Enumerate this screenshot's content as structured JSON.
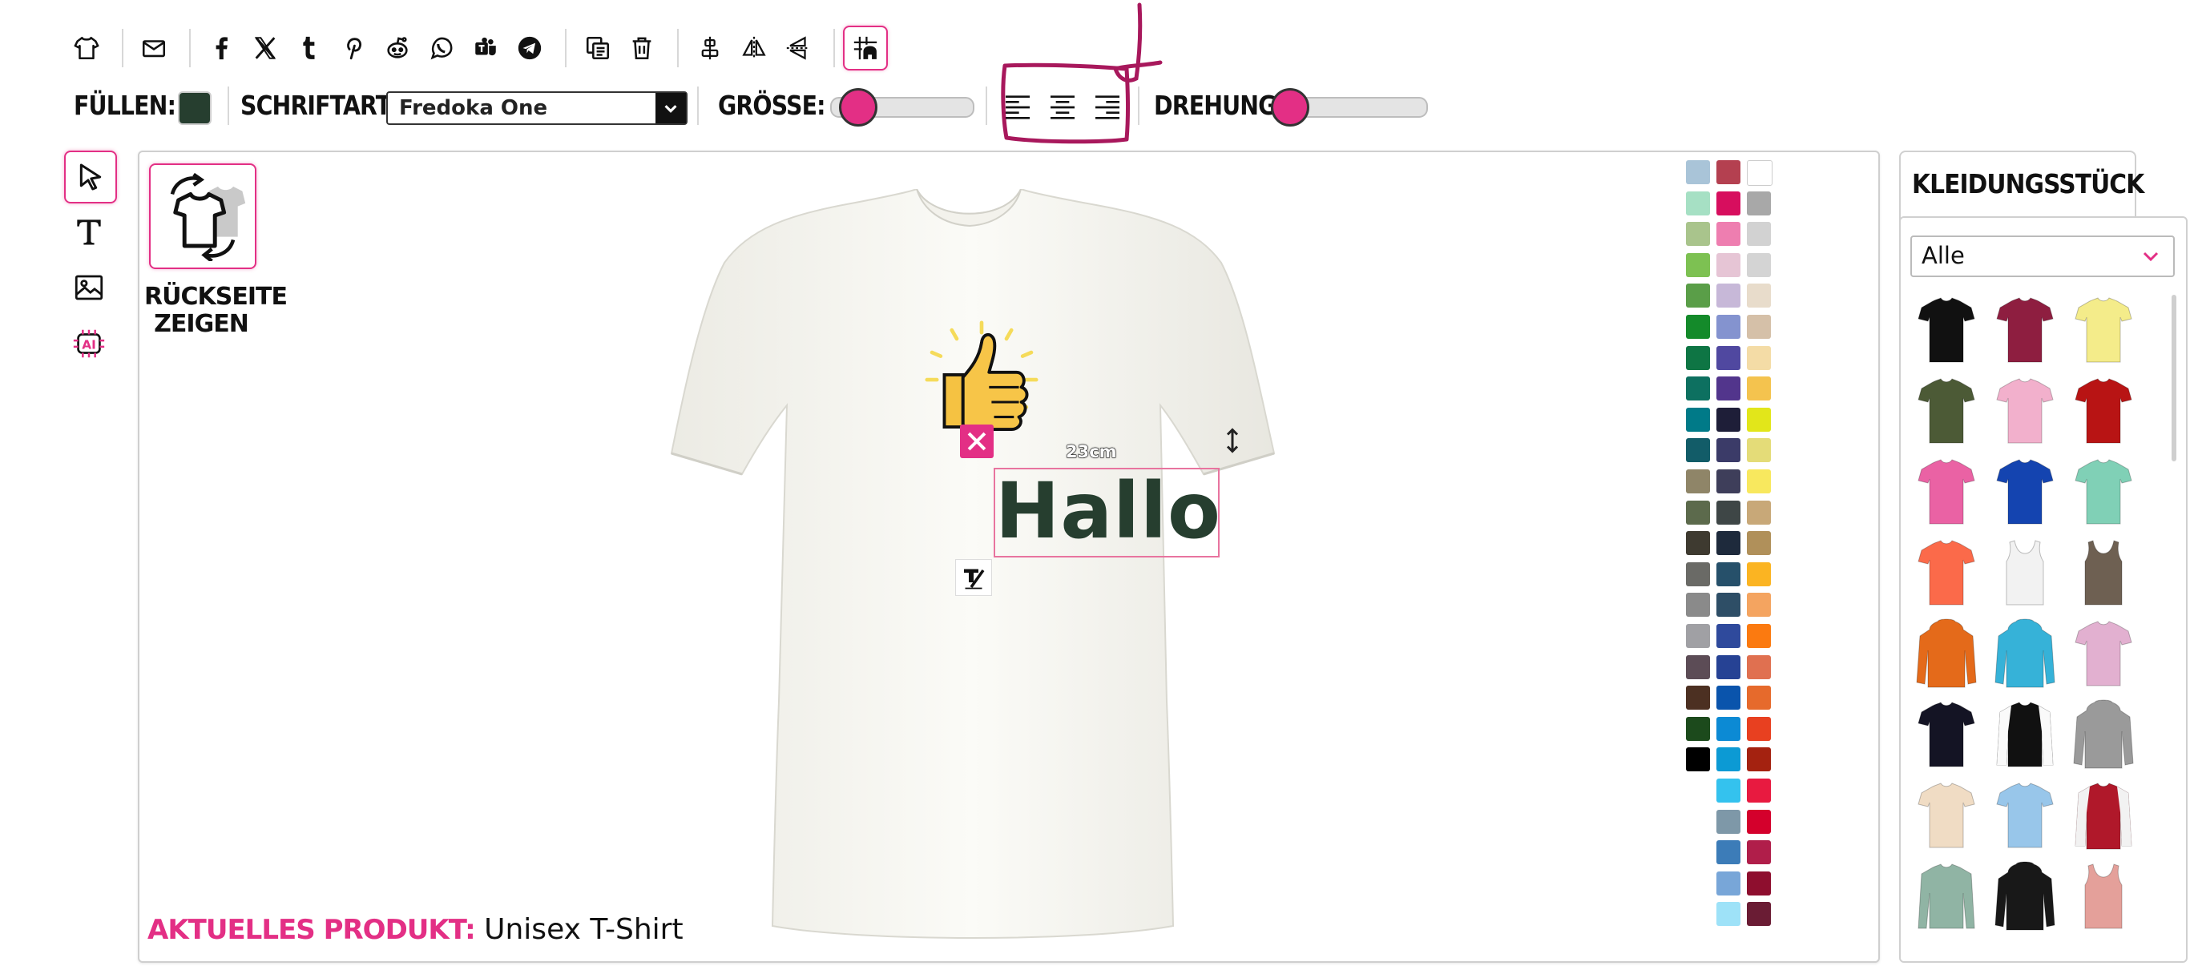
{
  "toolbar": {
    "icons": [
      "shirt-icon",
      "mail-icon",
      "facebook-icon",
      "x-icon",
      "tumblr-icon",
      "pinterest-icon",
      "reddit-icon",
      "whatsapp-icon",
      "teams-icon",
      "telegram-icon",
      "duplicate-icon",
      "delete-icon",
      "align-center-icon",
      "flip-horizontal-icon",
      "flip-vertical-icon",
      "grid-snap-icon"
    ]
  },
  "properties": {
    "fill_label": "FÜLLEN:",
    "fill_color": "#263e2f",
    "font_label": "SCHRIFTART:",
    "font_value": "Fredoka One",
    "size_label": "GRÖSSE:",
    "size_value": 0.1,
    "rotation_label": "DREHUNG:",
    "rotation_value": 0.0
  },
  "canvas": {
    "back_button_label_1": "RÜCKSEITE",
    "back_button_label_2": "ZEIGEN",
    "text_object": "Hallo",
    "text_color": "#263e2f",
    "dimension_label": "23cm",
    "current_product_label": "AKTUELLES PRODUKT:",
    "current_product_value": "Unisex T-Shirt"
  },
  "palette": {
    "colors": [
      [
        "#a9c4d8",
        "#b44050",
        "#ffffff"
      ],
      [
        "#a6e0c4",
        "#d70e5e",
        "#a8a8a8"
      ],
      [
        "#a9c48c",
        "#ee7eb0",
        "#d2d2d2"
      ],
      [
        "#7dc152",
        "#e6c5d5",
        "#d4d4d4"
      ],
      [
        "#5a9e48",
        "#c7b8d8",
        "#e8dccb"
      ],
      [
        "#148a2a",
        "#8493cf",
        "#d5c0a8"
      ],
      [
        "#0e7544",
        "#5048a0",
        "#f4dca6"
      ],
      [
        "#0d7060",
        "#52358c",
        "#f4c34e"
      ],
      [
        "#007a88",
        "#1e1e38",
        "#e2e61a"
      ],
      [
        "#125c68",
        "#3b3b68",
        "#e4dc78"
      ],
      [
        "#8f8568",
        "#3e3e5a",
        "#f8e85e"
      ],
      [
        "#5c6a4c",
        "#3e4646",
        "#c8a878"
      ],
      [
        "#3e3a30",
        "#1e2a3c",
        "#b0905a"
      ],
      [
        "#6a6a66",
        "#26506a",
        "#fbb422"
      ],
      [
        "#8a8a8a",
        "#2e4e66",
        "#f4a460"
      ],
      [
        "#a0a0a4",
        "#2f4a9c",
        "#fb7a10"
      ],
      [
        "#5c4c56",
        "#264294",
        "#e07050"
      ],
      [
        "#4c3022",
        "#0a54ac",
        "#e66a2c"
      ],
      [
        "#1c4a1c",
        "#0c8ad4",
        "#e84020"
      ],
      [
        "#000000",
        "#0c9ad4",
        "#a42210"
      ],
      [
        "",
        "#34c2ee",
        "#e81a40"
      ],
      [
        "",
        "#7e98a8",
        "#d4002c"
      ],
      [
        "",
        "#3c7cb8",
        "#b01e4a"
      ],
      [
        "",
        "#78a6d8",
        "#8e0e2e"
      ],
      [
        "",
        "#9ee2f8",
        "#6a1c34"
      ]
    ]
  },
  "garments": {
    "tab_label": "KLEIDUNGSSTÜCK",
    "filter_value": "Alle",
    "items": [
      {
        "kind": "tee",
        "color": "#111111"
      },
      {
        "kind": "tee",
        "color": "#8e1e40"
      },
      {
        "kind": "tee",
        "color": "#f4ec8a"
      },
      {
        "kind": "tee",
        "color": "#4c5a36"
      },
      {
        "kind": "tee",
        "color": "#f2b0cc"
      },
      {
        "kind": "tee",
        "color": "#b81414"
      },
      {
        "kind": "tee",
        "color": "#ea62a4"
      },
      {
        "kind": "tee",
        "color": "#1444b0"
      },
      {
        "kind": "tee",
        "color": "#80d0b6"
      },
      {
        "kind": "tee",
        "color": "#fb6a4a"
      },
      {
        "kind": "tank",
        "color": "#f2f2f2"
      },
      {
        "kind": "tank",
        "color": "#6e6052"
      },
      {
        "kind": "hoodie",
        "color": "#e46a1a"
      },
      {
        "kind": "hoodie",
        "color": "#36b2d8"
      },
      {
        "kind": "tee",
        "color": "#e2b0d0"
      },
      {
        "kind": "tee",
        "color": "#141424"
      },
      {
        "kind": "raglan",
        "color": "#111111"
      },
      {
        "kind": "hoodie",
        "color": "#9a9a9a"
      },
      {
        "kind": "tee",
        "color": "#f0dcc4"
      },
      {
        "kind": "tee",
        "color": "#98c6ea"
      },
      {
        "kind": "jacket",
        "color": "#b0182a"
      },
      {
        "kind": "longsleeve",
        "color": "#90b4a4"
      },
      {
        "kind": "hoodie",
        "color": "#181818"
      },
      {
        "kind": "tank",
        "color": "#e4a09a"
      }
    ]
  }
}
